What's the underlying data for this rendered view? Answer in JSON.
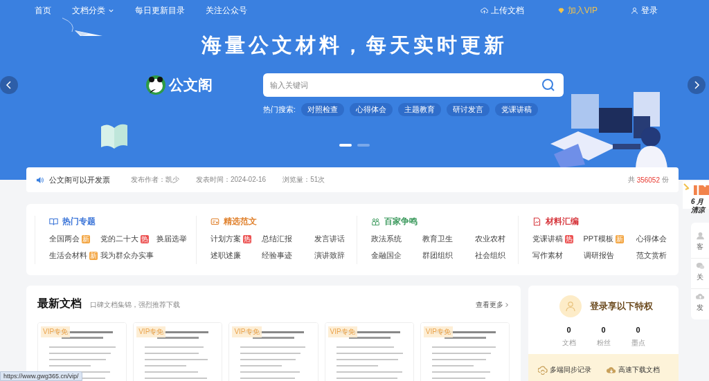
{
  "nav": {
    "items": [
      {
        "label": "首页",
        "dropdown": false
      },
      {
        "label": "文档分类",
        "dropdown": true
      },
      {
        "label": "每日更新目录",
        "dropdown": false
      },
      {
        "label": "关注公众号",
        "dropdown": false
      }
    ],
    "actions": [
      {
        "label": "上传文档",
        "kind": "upload"
      },
      {
        "label": "加入VIP",
        "kind": "vip"
      },
      {
        "label": "登录",
        "kind": "user"
      }
    ]
  },
  "banner": {
    "headline": "海量公文材料，每天实时更新",
    "logo": "公文阁",
    "search": {
      "placeholder": "输入关键词"
    },
    "hot_label": "热门搜索:",
    "hot_tags": [
      "对照检查",
      "心得体会",
      "主题教育",
      "研讨发言",
      "党课讲稿"
    ],
    "slides": [
      {
        "selected": true
      },
      {
        "selected": false
      }
    ]
  },
  "notice": {
    "text": "公文阁可以开发票",
    "author": "发布作者：凯少",
    "date": "发表时间：2024-02-16",
    "views": "浏览量：51次",
    "total_prefix": "共",
    "total": "356052",
    "total_suffix": "份"
  },
  "categories": [
    {
      "title": "热门专题",
      "kind": "book",
      "color": "#3a74d8",
      "items": [
        {
          "label": "全国两会",
          "badge": {
            "text": "新",
            "kind": "new"
          }
        },
        {
          "label": "党的二十大",
          "badge": {
            "text": "热",
            "kind": "hot"
          }
        },
        {
          "label": "换届选举"
        },
        {
          "label": "生活会材料",
          "badge": {
            "text": "新",
            "kind": "new"
          }
        },
        {
          "label": "我为群众办实事"
        }
      ]
    },
    {
      "title": "精选范文",
      "kind": "card",
      "color": "#e0812d",
      "items": [
        {
          "label": "计划方案",
          "badge": {
            "text": "热",
            "kind": "hot"
          }
        },
        {
          "label": "总结汇报"
        },
        {
          "label": "发言讲话"
        },
        {
          "label": "述职述廉"
        },
        {
          "label": "经验事迹"
        },
        {
          "label": "演讲致辞"
        }
      ]
    },
    {
      "title": "百家争鸣",
      "kind": "people",
      "color": "#3d9a5e",
      "items": [
        {
          "label": "政法系统"
        },
        {
          "label": "教育卫生"
        },
        {
          "label": "农业农村"
        },
        {
          "label": "金融国企"
        },
        {
          "label": "群团组织"
        },
        {
          "label": "社会组织"
        }
      ]
    },
    {
      "title": "材料汇编",
      "kind": "chart",
      "color": "#d6373d",
      "items": [
        {
          "label": "党课讲稿",
          "badge": {
            "text": "热",
            "kind": "hot"
          }
        },
        {
          "label": "PPT模板",
          "badge": {
            "text": "新",
            "kind": "new"
          }
        },
        {
          "label": "心得体会"
        },
        {
          "label": "写作素材"
        },
        {
          "label": "调研报告"
        },
        {
          "label": "范文赏析"
        }
      ]
    }
  ],
  "latest": {
    "title": "最新文档",
    "subtitle": "口碑文档集锦，强烈推荐下载",
    "more": "查看更多",
    "docs": [
      {
        "kind": "picture",
        "badge": "VIP专免"
      },
      {
        "kind": "picture",
        "badge": "VIP专免"
      },
      {
        "kind": "picture",
        "badge": "VIP专免"
      },
      {
        "kind": "picture",
        "badge": "VIP专免"
      },
      {
        "kind": "picture",
        "badge": "VIP专免"
      }
    ]
  },
  "login": {
    "title": "登录享以下特权",
    "stats": [
      {
        "value": "0",
        "label": "文档"
      },
      {
        "value": "0",
        "label": "粉丝"
      },
      {
        "value": "0",
        "label": "墨点"
      }
    ],
    "perks": [
      {
        "label": "多端同步记录",
        "kind": "sync"
      },
      {
        "label": "高速下载文档",
        "kind": "download"
      }
    ]
  },
  "side": {
    "promo": [
      "6 月",
      "清凉"
    ],
    "items": [
      {
        "label": "客",
        "kind": "service"
      },
      {
        "label": "关",
        "kind": "chat"
      },
      {
        "label": "发",
        "kind": "upload"
      }
    ]
  },
  "status_url": "https://www.gwg365.cn/vip/"
}
